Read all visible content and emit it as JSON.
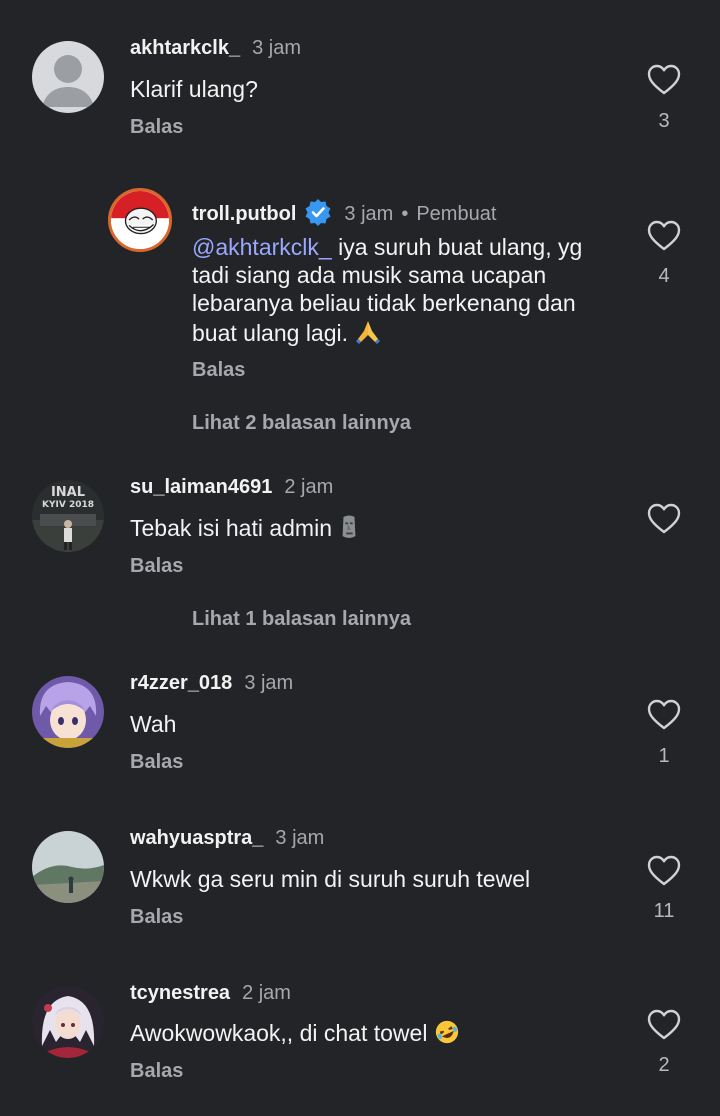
{
  "comments": [
    {
      "username": "akhtarkclk_",
      "time": "3 jam",
      "text": "Klarif ulang?",
      "reply_label": "Balas",
      "likes": "3"
    },
    {
      "username": "troll.putbol",
      "time": "3 jam",
      "creator_label": "Pembuat",
      "mention": "@akhtarkclk_",
      "text_lines": [
        "iya suruh buat ulang, yg",
        "tadi siang ada musik sama ucapan",
        "lebaranya beliau tidak berkenang dan",
        "buat ulang lagi."
      ],
      "reply_label": "Balas",
      "likes": "4",
      "more_replies": "Lihat 2 balasan lainnya"
    },
    {
      "username": "su_laiman4691",
      "time": "2 jam",
      "text": "Tebak isi hati admin",
      "reply_label": "Balas",
      "more_replies": "Lihat 1 balasan lainnya"
    },
    {
      "username": "r4zzer_018",
      "time": "3 jam",
      "text": "Wah",
      "reply_label": "Balas",
      "likes": "1"
    },
    {
      "username": "wahyuasptra_",
      "time": "3 jam",
      "text": "Wkwk ga seru min di suruh suruh tewel",
      "reply_label": "Balas",
      "likes": "11"
    },
    {
      "username": "tcynestrea",
      "time": "2 jam",
      "text": "Awokwowkaok,, di chat towel",
      "reply_label": "Balas",
      "likes": "2"
    }
  ],
  "avatar_text": {
    "su_laiman4691": [
      "INAL",
      "KYIV 2018"
    ]
  },
  "colors": {
    "background": "#232427",
    "secondary_text": "#a6a8ad",
    "mention": "#9aa8ff",
    "verified": "#3897f0"
  }
}
